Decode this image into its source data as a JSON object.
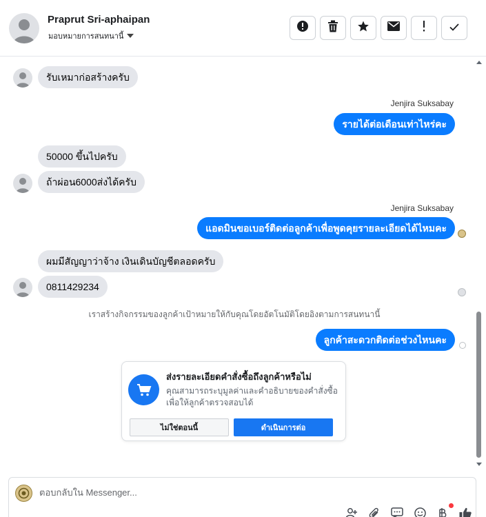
{
  "header": {
    "contact_name": "Praprut Sri-aphaipan",
    "assign_label": "มอบหมายการสนทนานี้",
    "actions": [
      {
        "icon": "alert-circle-icon"
      },
      {
        "icon": "trash-icon"
      },
      {
        "icon": "star-icon"
      },
      {
        "icon": "envelope-icon"
      },
      {
        "icon": "exclamation-icon"
      },
      {
        "icon": "checkmark-icon"
      }
    ]
  },
  "conversation": {
    "messages": [
      {
        "direction": "in",
        "text": "รับเหมาก่อสร้างครับ"
      },
      {
        "direction": "out",
        "sender": "Jenjira Suksabay",
        "text": "รายได้ต่อเดือนเท่าไหร่คะ"
      },
      {
        "direction": "in",
        "text": "50000 ขึ้นไปครับ"
      },
      {
        "direction": "in",
        "text": "ถ้าผ่อน6000ส่งได้ครับ"
      },
      {
        "direction": "out",
        "sender": "Jenjira Suksabay",
        "text": "แอดมินขอเบอร์ติดต่อลูกค้าเพื่อพูดคุยรายละเอียดได้ไหมคะ"
      },
      {
        "direction": "in",
        "text": "ผมมีสัญญาว่าจ้าง เงินเดินบัญชีตลอดครับ"
      },
      {
        "direction": "in",
        "text": "0811429234"
      },
      {
        "direction": "out",
        "text": "ลูกค้าสะดวกติดต่อช่วงไหนคะ"
      }
    ],
    "system_notice": "เราสร้างกิจกรรมของลูกค้าเป้าหมายให้กับคุณโดยอัตโนมัติโดยอิงตามการสนทนานี้"
  },
  "order_prompt": {
    "title": "ส่งรายละเอียดคำสั่งซื้อถึงลูกค้าหรือไม่",
    "description": "คุณสามารถระบุมูลค่าและคำอธิบายของคำสั่งซื้อเพื่อให้ลูกค้าตรวจสอบได้",
    "decline_label": "ไม่ใช่ตอนนี้",
    "confirm_label": "ดำเนินการต่อ"
  },
  "composer": {
    "placeholder": "ตอบกลับใน Messenger...",
    "tools": [
      "add-contact-icon",
      "paperclip-icon",
      "saved-replies-icon",
      "emoji-icon",
      "baht-payment-icon",
      "thumbs-up-icon"
    ]
  },
  "colors": {
    "outgoing_bubble": "#0a7cff",
    "incoming_bubble": "#e4e6eb",
    "primary_button": "#1877f2"
  }
}
